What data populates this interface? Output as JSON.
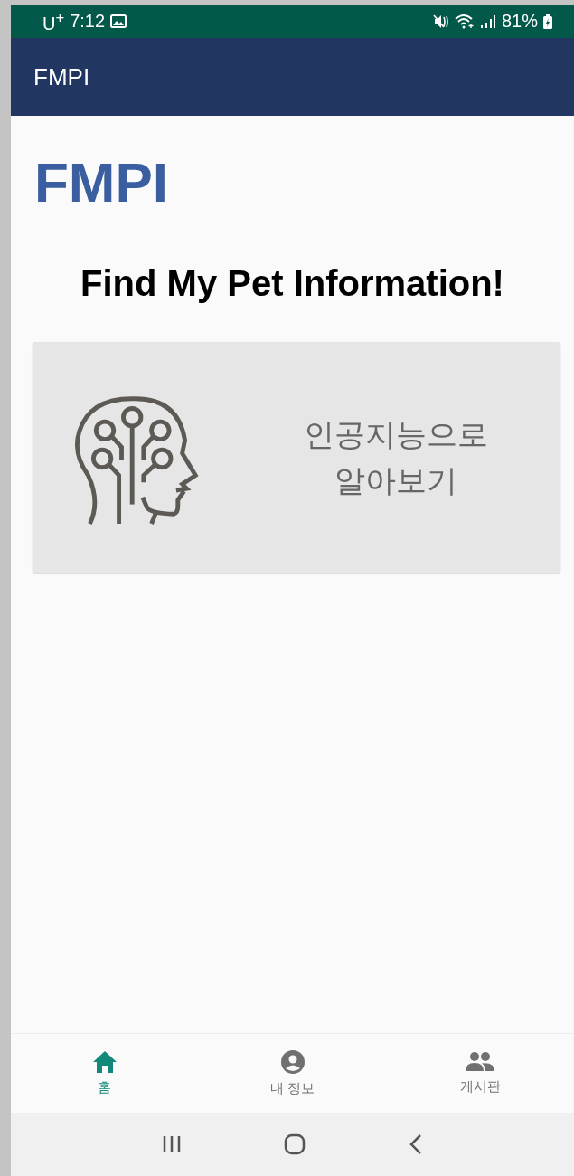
{
  "status_bar": {
    "carrier": "U$^{+}$",
    "time": "7:12",
    "battery": "81%"
  },
  "app_bar": {
    "title": "FMPI"
  },
  "logo": "FMPI",
  "heading": "Find My Pet Information!",
  "cards": [
    {
      "label": "인공지능으로\n알아보기",
      "kind": "ai"
    }
  ],
  "bottom_nav": [
    {
      "label": "홈",
      "kind": "home",
      "selected": true
    },
    {
      "label": "내 정보",
      "kind": "profile",
      "selected": false
    },
    {
      "label": "게시판",
      "kind": "board",
      "selected": false
    }
  ]
}
